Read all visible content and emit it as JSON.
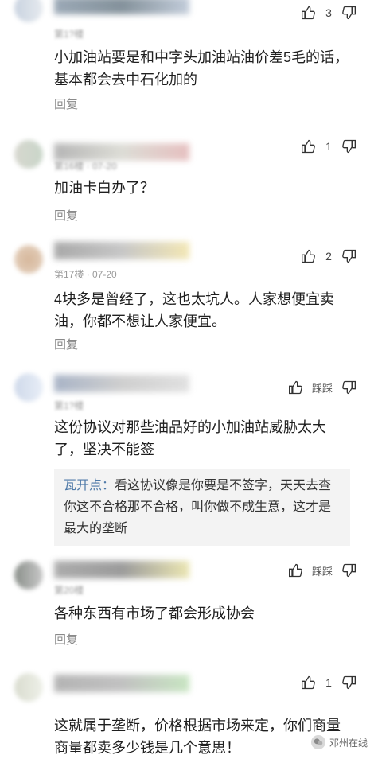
{
  "comments": [
    {
      "meta": "第1?楼",
      "text": "小加油站要是和中字头加油站油价差5毛的话，基本都会去中石化加的",
      "reply": "回复",
      "like_count": "3",
      "colors": [
        "#c9d3e0",
        "#8a9aaa",
        "#6f7f8a",
        "#b8c4d4"
      ]
    },
    {
      "meta": "第16楼 · 07-20",
      "text": "加油卡白办了？",
      "reply": "回复",
      "like_count": "1",
      "colors": [
        "#d7d7cf",
        "#c9d6c9",
        "#a9a9a9",
        "#e2b5b5"
      ]
    },
    {
      "meta": "第17楼 · 07-20",
      "text": "4块多是曾经了，这也太坑人。人家想便宜卖油，你都不想让人家便宜。",
      "reply": "回复",
      "like_count": "2",
      "colors": [
        "#d6b79b",
        "#9a9a9a",
        "#bdbdbd",
        "#f1e3a8"
      ]
    },
    {
      "meta": "第1?楼",
      "text": "这份协议对那些油品好的小加油站威胁太大了，坚决不能签",
      "dislike_label": "踩踩",
      "colors": [
        "#cfd9ea",
        "#9aa7bd",
        "#c7c7c7",
        "#dcdcdc"
      ],
      "subreply_author": "瓦开点：",
      "subreply_text": "看这协议像是你要是不签字，天天去查你这不合格那不合格，叫你做不成生意，这才是最大的垄断"
    },
    {
      "meta": "第20楼",
      "text": "各种东西有市场了都会形成协会",
      "reply": "回复",
      "dislike_label": "踩踩",
      "colors": [
        "#8a8f8a",
        "#9e9e9e",
        "#8a8a8a",
        "#e8e2a5"
      ]
    },
    {
      "meta": "",
      "text": "这就属于垄断，价格根据市场来定，你们商量商量都卖多少钱是几个意思！",
      "like_count": "1",
      "colors": [
        "#d9dccf",
        "#a7a7a7",
        "#b7b7b7",
        "#bfe1b8"
      ]
    }
  ],
  "icons": {
    "like": "thumbs-up-icon",
    "dislike": "thumbs-down-icon"
  },
  "watermark": {
    "text": "邓州在线"
  }
}
